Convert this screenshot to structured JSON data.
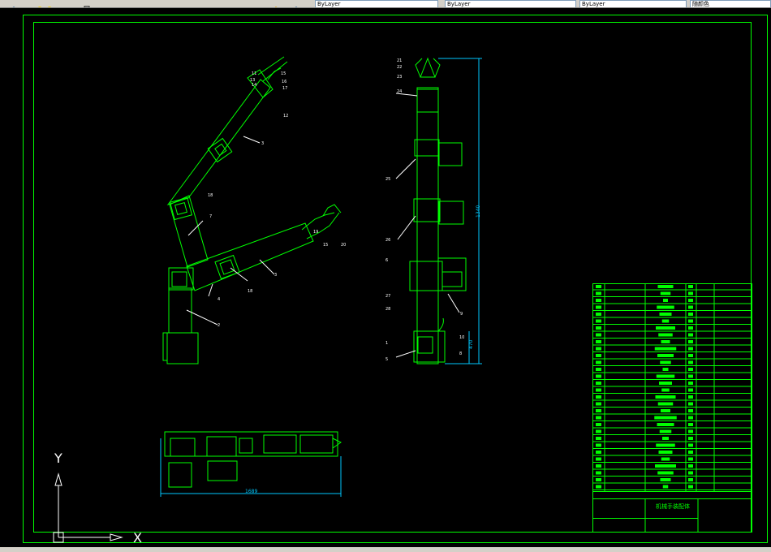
{
  "toolbar": {
    "dropdowns": [
      "ByLayer",
      "ByLayer",
      "ByLayer",
      "ByLayer"
    ],
    "right_box": "随颜色"
  },
  "drawing": {
    "title_block_name": "机械手装配体",
    "dimension_top": "1340",
    "dimension_bottom": "1689",
    "dimension_left": "470",
    "part_labels_arm1": [
      "11",
      "13",
      "14",
      "15",
      "16",
      "17",
      "12",
      "3",
      "18",
      "7"
    ],
    "part_labels_arm2": [
      "19",
      "15",
      "20",
      "3",
      "4",
      "18",
      "2"
    ],
    "part_labels_side": [
      "21",
      "22",
      "23",
      "24",
      "25",
      "26",
      "6",
      "1",
      "5",
      "27",
      "28",
      "10",
      "8",
      "9"
    ]
  },
  "ucs": {
    "x_label": "X",
    "y_label": "Y"
  },
  "colors": {
    "frame": "#00ff00",
    "lines": "#00ff00",
    "dims": "#00c8ff",
    "labels": "#ffffff"
  }
}
